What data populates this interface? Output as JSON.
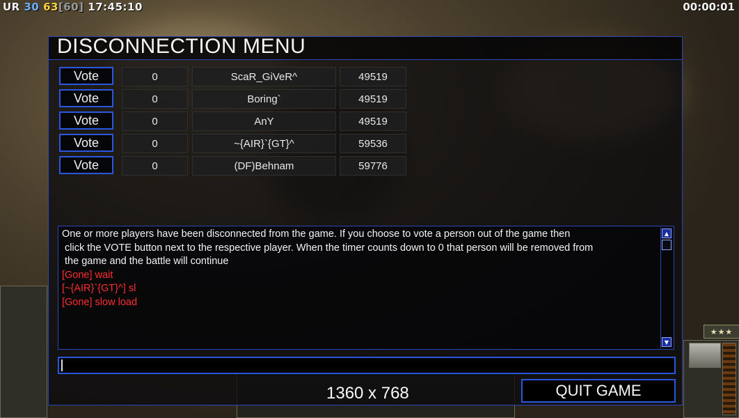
{
  "hud": {
    "faction": "UR",
    "fps_value": "30",
    "fps_current": "63",
    "fps_cap": "[60]",
    "clock": "17:45:10",
    "game_timer": "00:00:01",
    "rank_stars": "★★★"
  },
  "menu": {
    "title": "DISCONNECTION MENU",
    "players": [
      {
        "vote_label": "Vote",
        "count": "0",
        "name": "ScaR_GiVeR^",
        "ping": "49519"
      },
      {
        "vote_label": "Vote",
        "count": "0",
        "name": "Boring`",
        "ping": "49519"
      },
      {
        "vote_label": "Vote",
        "count": "0",
        "name": "AnY",
        "ping": "49519"
      },
      {
        "vote_label": "Vote",
        "count": "0",
        "name": "~{AIR}`{GT}^",
        "ping": "59536"
      },
      {
        "vote_label": "Vote",
        "count": "0",
        "name": "(DF)Behnam",
        "ping": "59776"
      }
    ],
    "chat": {
      "info_line1": "One or more players have been disconnected from the game. If you choose to vote a person out of the game then",
      "info_line2": " click the VOTE button next to the respective player. When the timer counts down to 0 that person will be removed from",
      "info_line3": " the game and the battle will continue",
      "messages": [
        "[Gone] wait",
        "[~{AIR}`{GT}^] sl",
        "[Gone] slow load"
      ]
    },
    "chat_input_value": "",
    "resolution_label": "1360 x 768",
    "quit_label": "QUIT GAME"
  },
  "colors": {
    "accent_border": "#2b57e0",
    "chat_red": "#ff2d2d",
    "fps_blue": "#6fb1ff",
    "fps_yellow": "#ffd23c"
  }
}
